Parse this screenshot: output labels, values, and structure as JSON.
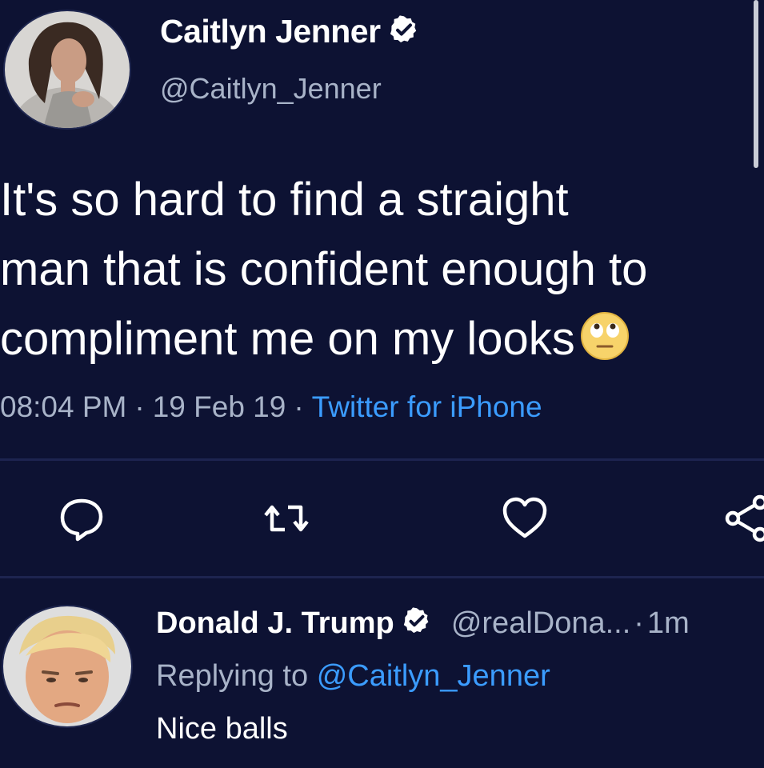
{
  "tweet": {
    "author_name": "Caitlyn Jenner",
    "author_handle": "@Caitlyn_Jenner",
    "verified": true,
    "text_lines": [
      "It's so hard to find a straight",
      "man that is confident enough to",
      "compliment me on my looks"
    ],
    "emoji": "rolling-eyes-emoji",
    "time": "08:04 PM",
    "date": "19 Feb 19",
    "separator": "·",
    "source": "Twitter for iPhone",
    "actions": [
      "reply-icon",
      "retweet-icon",
      "like-icon",
      "share-icon"
    ]
  },
  "reply": {
    "author_name": "Donald J. Trump",
    "author_handle": "@realDona...",
    "separator": "·",
    "time": "1m",
    "verified": true,
    "replying_prefix": "Replying to",
    "replying_to": "@Caitlyn_Jenner",
    "text": "Nice balls"
  },
  "colors": {
    "background": "#0d1233",
    "primary_text": "#ffffff",
    "secondary_text": "#a8b3c8",
    "accent": "#3b9cff",
    "divider": "#1d2450"
  }
}
